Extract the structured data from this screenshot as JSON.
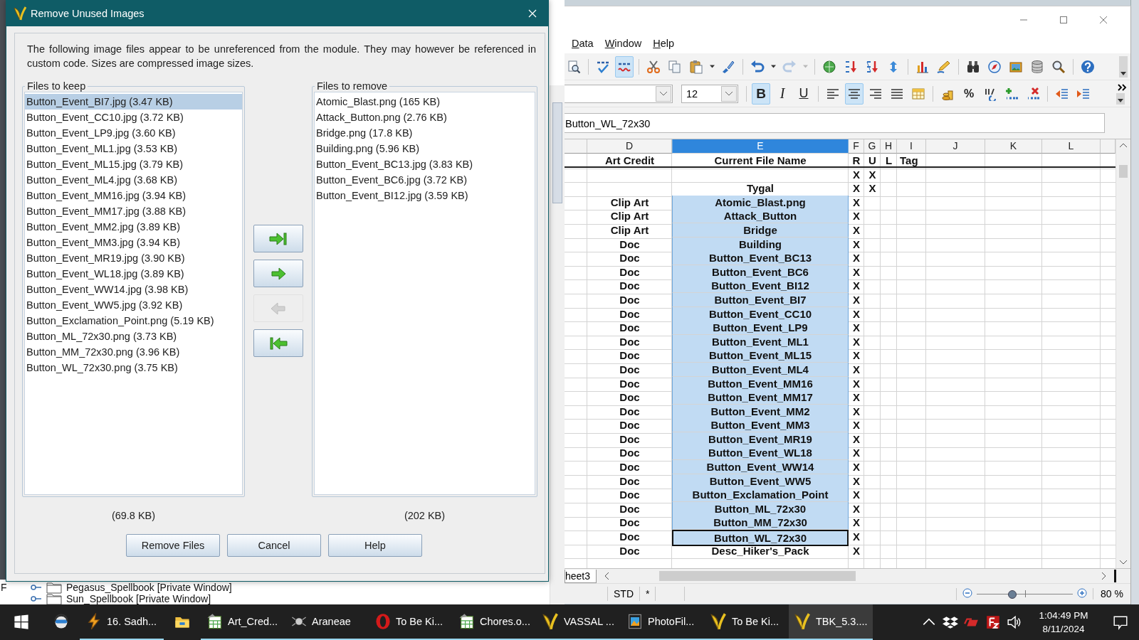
{
  "back_window": {
    "edge_letter": "F",
    "tree": [
      {
        "label": "Pegasus_Spellbook [Private Window]"
      },
      {
        "label": "Sun_Spellbook [Private Window]"
      }
    ]
  },
  "dialog": {
    "title": "Remove Unused Images",
    "message": "The following image files appear to be unreferenced from the module. They may however be referenced in custom code. Sizes are compressed image sizes.",
    "keep": {
      "legend": "Files to keep",
      "total": "(69.8 KB)",
      "items": [
        {
          "label": "Button_Event_BI7.jpg (3.47 KB)",
          "selected": true
        },
        {
          "label": "Button_Event_CC10.jpg (3.72 KB)",
          "selected": false
        },
        {
          "label": "Button_Event_LP9.jpg (3.60 KB)",
          "selected": false
        },
        {
          "label": "Button_Event_ML1.jpg (3.53 KB)",
          "selected": false
        },
        {
          "label": "Button_Event_ML15.jpg (3.79 KB)",
          "selected": false
        },
        {
          "label": "Button_Event_ML4.jpg (3.68 KB)",
          "selected": false
        },
        {
          "label": "Button_Event_MM16.jpg (3.94 KB)",
          "selected": false
        },
        {
          "label": "Button_Event_MM17.jpg (3.88 KB)",
          "selected": false
        },
        {
          "label": "Button_Event_MM2.jpg (3.89 KB)",
          "selected": false
        },
        {
          "label": "Button_Event_MM3.jpg (3.94 KB)",
          "selected": false
        },
        {
          "label": "Button_Event_MR19.jpg (3.90 KB)",
          "selected": false
        },
        {
          "label": "Button_Event_WL18.jpg (3.89 KB)",
          "selected": false
        },
        {
          "label": "Button_Event_WW14.jpg (3.98 KB)",
          "selected": false
        },
        {
          "label": "Button_Event_WW5.jpg (3.92 KB)",
          "selected": false
        },
        {
          "label": "Button_Exclamation_Point.png (5.19 KB)",
          "selected": false
        },
        {
          "label": "Button_ML_72x30.png (3.73 KB)",
          "selected": false
        },
        {
          "label": "Button_MM_72x30.png (3.96 KB)",
          "selected": false
        },
        {
          "label": "Button_WL_72x30.png (3.75 KB)",
          "selected": false
        }
      ]
    },
    "remove": {
      "legend": "Files to remove",
      "total": "(202 KB)",
      "items": [
        {
          "label": "Atomic_Blast.png (165 KB)",
          "selected": false
        },
        {
          "label": "Attack_Button.png (2.76 KB)",
          "selected": false
        },
        {
          "label": "Bridge.png (17.8 KB)",
          "selected": false
        },
        {
          "label": "Building.png (5.96 KB)",
          "selected": false
        },
        {
          "label": "Button_Event_BC13.jpg (3.83 KB)",
          "selected": false
        },
        {
          "label": "Button_Event_BC6.jpg (3.72 KB)",
          "selected": false
        },
        {
          "label": "Button_Event_BI12.jpg (3.59 KB)",
          "selected": false
        }
      ]
    },
    "move_buttons": [
      {
        "kind": "all-right",
        "disabled": false
      },
      {
        "kind": "right",
        "disabled": false
      },
      {
        "kind": "left",
        "disabled": true
      },
      {
        "kind": "all-left",
        "disabled": false
      }
    ],
    "buttons": [
      "Remove Files",
      "Cancel",
      "Help"
    ]
  },
  "spreadsheet": {
    "menu": [
      "Data",
      "Window",
      "Help"
    ],
    "toolbar_1": [
      {
        "kind": "preview",
        "on": false,
        "disabled": false
      },
      {
        "kind": "separator"
      },
      {
        "kind": "spellcheck",
        "on": false,
        "disabled": false
      },
      {
        "kind": "autospell",
        "on": true,
        "disabled": false
      },
      {
        "kind": "separator"
      },
      {
        "kind": "cut",
        "on": false,
        "disabled": false
      },
      {
        "kind": "copy",
        "on": false,
        "disabled": false
      },
      {
        "kind": "paste",
        "on": false,
        "disabled": false
      },
      {
        "kind": "dropdown",
        "on": false,
        "disabled": false
      },
      {
        "kind": "brush",
        "on": false,
        "disabled": false
      },
      {
        "kind": "separator"
      },
      {
        "kind": "undo",
        "on": false,
        "disabled": false
      },
      {
        "kind": "dropdown",
        "on": false,
        "disabled": false
      },
      {
        "kind": "redo",
        "on": false,
        "disabled": true
      },
      {
        "kind": "dropdown",
        "on": false,
        "disabled": true
      },
      {
        "kind": "separator"
      },
      {
        "kind": "hyperlink",
        "on": false,
        "disabled": false
      },
      {
        "kind": "sort-ascending",
        "on": false,
        "disabled": false
      },
      {
        "kind": "sort-descending",
        "on": false,
        "disabled": false
      },
      {
        "kind": "sort-updown",
        "on": false,
        "disabled": false
      },
      {
        "kind": "separator"
      },
      {
        "kind": "chart",
        "on": false,
        "disabled": false
      },
      {
        "kind": "drawing",
        "on": false,
        "disabled": false
      },
      {
        "kind": "separator"
      },
      {
        "kind": "find",
        "on": false,
        "disabled": false
      },
      {
        "kind": "navigator",
        "on": false,
        "disabled": false
      },
      {
        "kind": "gallery",
        "on": false,
        "disabled": false
      },
      {
        "kind": "datasource",
        "on": false,
        "disabled": false
      },
      {
        "kind": "zoom",
        "on": false,
        "disabled": false
      },
      {
        "kind": "separator"
      },
      {
        "kind": "help",
        "on": false,
        "disabled": false
      }
    ],
    "font_size": "12",
    "toolbar_2": [
      {
        "kind": "bold",
        "label": "B",
        "on": true,
        "disabled": false
      },
      {
        "kind": "italic",
        "label": "I",
        "on": false,
        "disabled": false
      },
      {
        "kind": "underline",
        "label": "U",
        "on": false,
        "disabled": false
      },
      {
        "kind": "separator"
      },
      {
        "kind": "align-left",
        "on": false,
        "disabled": false
      },
      {
        "kind": "align-center",
        "on": true,
        "disabled": false
      },
      {
        "kind": "align-right",
        "on": false,
        "disabled": false
      },
      {
        "kind": "justify",
        "on": false,
        "disabled": false
      },
      {
        "kind": "merge",
        "on": false,
        "disabled": false
      },
      {
        "kind": "separator"
      },
      {
        "kind": "currency",
        "on": false,
        "disabled": false
      },
      {
        "kind": "percent",
        "label": "%",
        "on": false,
        "disabled": false
      },
      {
        "kind": "number-format",
        "on": false,
        "disabled": false
      },
      {
        "kind": "add-decimal",
        "on": false,
        "disabled": false
      },
      {
        "kind": "delete-decimal",
        "on": false,
        "disabled": false
      },
      {
        "kind": "separator"
      },
      {
        "kind": "decrease-indent",
        "on": false,
        "disabled": false
      },
      {
        "kind": "increase-indent",
        "on": false,
        "disabled": false
      }
    ],
    "formula": "Button_WL_72x30",
    "columns": [
      {
        "label": "D",
        "selected": false
      },
      {
        "label": "E",
        "selected": true
      },
      {
        "label": "F",
        "selected": false
      },
      {
        "label": "G",
        "selected": false
      },
      {
        "label": "H",
        "selected": false
      },
      {
        "label": "I",
        "selected": false
      },
      {
        "label": "J",
        "selected": false
      },
      {
        "label": "K",
        "selected": false
      },
      {
        "label": "L",
        "selected": false
      }
    ],
    "rows": [
      {
        "cells": {
          "d": "Art Credit",
          "e": "Current File Name",
          "f": "R",
          "g": "U",
          "h": "L",
          "i": "Tag"
        },
        "selected": false,
        "current": false,
        "header": true
      },
      {
        "cells": {
          "f": "X",
          "g": "X"
        },
        "selected": false,
        "current": false
      },
      {
        "cells": {
          "e": "Tygal",
          "f": "X",
          "g": "X"
        },
        "selected": false,
        "current": false
      },
      {
        "cells": {
          "d": "Clip Art",
          "e": "Atomic_Blast.png",
          "f": "X"
        },
        "selected": true,
        "current": false
      },
      {
        "cells": {
          "d": "Clip Art",
          "e": "Attack_Button",
          "f": "X"
        },
        "selected": true,
        "current": false
      },
      {
        "cells": {
          "d": "Clip Art",
          "e": "Bridge",
          "f": "X"
        },
        "selected": true,
        "current": false
      },
      {
        "cells": {
          "d": "Doc",
          "e": "Building",
          "f": "X"
        },
        "selected": true,
        "current": false
      },
      {
        "cells": {
          "d": "Doc",
          "e": "Button_Event_BC13",
          "f": "X"
        },
        "selected": true,
        "current": false
      },
      {
        "cells": {
          "d": "Doc",
          "e": "Button_Event_BC6",
          "f": "X"
        },
        "selected": true,
        "current": false
      },
      {
        "cells": {
          "d": "Doc",
          "e": "Button_Event_BI12",
          "f": "X"
        },
        "selected": true,
        "current": false
      },
      {
        "cells": {
          "d": "Doc",
          "e": "Button_Event_BI7",
          "f": "X"
        },
        "selected": true,
        "current": false
      },
      {
        "cells": {
          "d": "Doc",
          "e": "Button_Event_CC10",
          "f": "X"
        },
        "selected": true,
        "current": false
      },
      {
        "cells": {
          "d": "Doc",
          "e": "Button_Event_LP9",
          "f": "X"
        },
        "selected": true,
        "current": false
      },
      {
        "cells": {
          "d": "Doc",
          "e": "Button_Event_ML1",
          "f": "X"
        },
        "selected": true,
        "current": false
      },
      {
        "cells": {
          "d": "Doc",
          "e": "Button_Event_ML15",
          "f": "X"
        },
        "selected": true,
        "current": false
      },
      {
        "cells": {
          "d": "Doc",
          "e": "Button_Event_ML4",
          "f": "X"
        },
        "selected": true,
        "current": false
      },
      {
        "cells": {
          "d": "Doc",
          "e": "Button_Event_MM16",
          "f": "X"
        },
        "selected": true,
        "current": false
      },
      {
        "cells": {
          "d": "Doc",
          "e": "Button_Event_MM17",
          "f": "X"
        },
        "selected": true,
        "current": false
      },
      {
        "cells": {
          "d": "Doc",
          "e": "Button_Event_MM2",
          "f": "X"
        },
        "selected": true,
        "current": false
      },
      {
        "cells": {
          "d": "Doc",
          "e": "Button_Event_MM3",
          "f": "X"
        },
        "selected": true,
        "current": false
      },
      {
        "cells": {
          "d": "Doc",
          "e": "Button_Event_MR19",
          "f": "X"
        },
        "selected": true,
        "current": false
      },
      {
        "cells": {
          "d": "Doc",
          "e": "Button_Event_WL18",
          "f": "X"
        },
        "selected": true,
        "current": false
      },
      {
        "cells": {
          "d": "Doc",
          "e": "Button_Event_WW14",
          "f": "X"
        },
        "selected": true,
        "current": false
      },
      {
        "cells": {
          "d": "Doc",
          "e": "Button_Event_WW5",
          "f": "X"
        },
        "selected": true,
        "current": false
      },
      {
        "cells": {
          "d": "Doc",
          "e": "Button_Exclamation_Point",
          "f": "X"
        },
        "selected": true,
        "current": false
      },
      {
        "cells": {
          "d": "Doc",
          "e": "Button_ML_72x30",
          "f": "X"
        },
        "selected": true,
        "current": false
      },
      {
        "cells": {
          "d": "Doc",
          "e": "Button_MM_72x30",
          "f": "X"
        },
        "selected": true,
        "current": false
      },
      {
        "cells": {
          "d": "Doc",
          "e": "Button_WL_72x30",
          "f": "X"
        },
        "selected": true,
        "current": true
      },
      {
        "cells": {
          "d": "Doc",
          "e": "Desc_Hiker's_Pack",
          "f": "X"
        },
        "selected": false,
        "current": false
      }
    ],
    "sheet_tab": "heet3",
    "status": {
      "mode": "STD",
      "modified": "*",
      "zoom": {
        "level": 0.36
      },
      "zoom_text": "80 %"
    }
  },
  "taskbar": {
    "items": [
      {
        "kind": "start",
        "open": false,
        "active": false
      },
      {
        "kind": "headset",
        "open": false,
        "active": false
      },
      {
        "kind": "lightning",
        "label": "16. Sadh...",
        "open": true,
        "active": false
      },
      {
        "kind": "folder",
        "open": false,
        "active": false
      },
      {
        "kind": "sheet",
        "label": "Art_Cred...",
        "open": true,
        "active": false
      },
      {
        "kind": "spider",
        "label": "Araneae",
        "open": true,
        "active": false
      },
      {
        "kind": "ring",
        "label": "To Be Ki...",
        "open": true,
        "active": false
      },
      {
        "kind": "sheet",
        "label": "Chores.o...",
        "open": true,
        "active": false
      },
      {
        "kind": "logo",
        "label": "VASSAL ...",
        "open": true,
        "active": false
      },
      {
        "kind": "film",
        "label": "PhotoFil...",
        "open": true,
        "active": false
      },
      {
        "kind": "logo",
        "label": "To Be Ki...",
        "open": true,
        "active": false
      },
      {
        "kind": "logo",
        "label": "TBK_5.3....",
        "open": true,
        "active": true
      }
    ],
    "time": "1:04:49 PM",
    "date": "8/11/2024"
  }
}
